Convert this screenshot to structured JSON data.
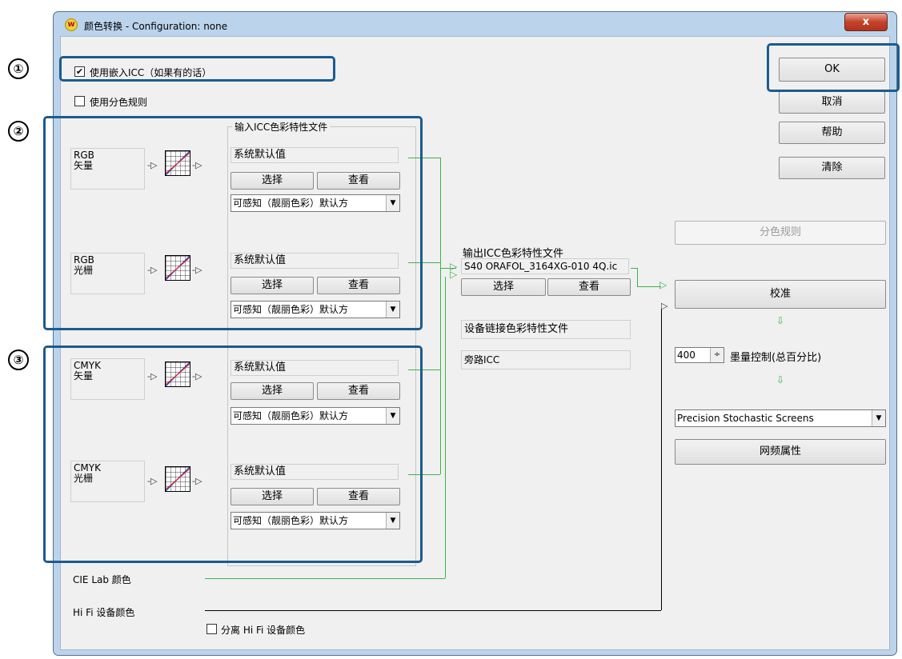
{
  "window": {
    "title": "颜色转换 - Configuration: none",
    "close_label": "x",
    "app_icon_glyph": "w"
  },
  "options": {
    "use_embedded_icc": "使用嵌入ICC（如果有的话）",
    "use_embedded_icc_checked": true,
    "use_separation_rules": "使用分色规则",
    "use_separation_rules_checked": false
  },
  "buttons": {
    "ok": "OK",
    "cancel": "取消",
    "help": "帮助",
    "clear": "清除",
    "separation_rules": "分色规则",
    "calibrate": "校准",
    "screen_properties": "网频属性"
  },
  "input_group_title": "输入ICC色彩特性文件",
  "sources": [
    {
      "label_line1": "RGB",
      "label_line2": "矢量",
      "profile": "系统默认值",
      "select": "选择",
      "view": "查看",
      "intent": "可感知（靓丽色彩）默认方"
    },
    {
      "label_line1": "RGB",
      "label_line2": "光栅",
      "profile": "系统默认值",
      "select": "选择",
      "view": "查看",
      "intent": "可感知（靓丽色彩）默认方"
    },
    {
      "label_line1": "CMYK",
      "label_line2": "矢量",
      "profile": "系统默认值",
      "select": "选择",
      "view": "查看",
      "intent": "可感知（靓丽色彩）默认方"
    },
    {
      "label_line1": "CMYK",
      "label_line2": "光栅",
      "profile": "系统默认值",
      "select": "选择",
      "view": "查看",
      "intent": "可感知（靓丽色彩）默认方"
    }
  ],
  "output": {
    "label": "输出ICC色彩特性文件",
    "profile": "S40 ORAFOL_3164XG-010 4Q.ic",
    "select": "选择",
    "view": "查看",
    "device_link": "设备链接色彩特性文件",
    "bypass": "旁路ICC"
  },
  "ink": {
    "value": "400",
    "label": "墨量控制(总百分比)"
  },
  "screening": {
    "selected": "Precision Stochastic Screens"
  },
  "extra": {
    "cie_lab": "CIE Lab 颜色",
    "hifi": "Hi Fi 设备颜色",
    "separate_hifi": "分离 Hi Fi 设备颜色",
    "separate_hifi_checked": false
  },
  "callouts": [
    "①",
    "②",
    "③"
  ],
  "colors": {
    "callout_border": "#1c5b8f",
    "flow_line": "#3cb34a",
    "window_frame": "#bcd3ec",
    "close_button": "#c4422a"
  }
}
